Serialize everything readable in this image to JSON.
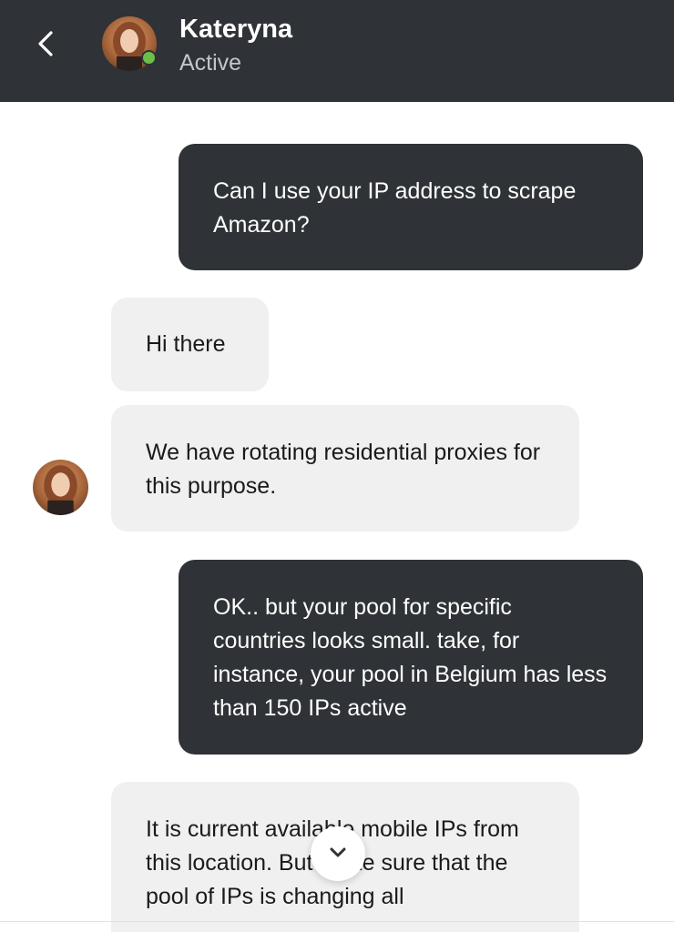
{
  "header": {
    "back_icon": "chevron-left-icon",
    "contact_name": "Kateryna",
    "status": "Active",
    "status_color": "#6cc04a",
    "background": "#2f3236"
  },
  "messages": [
    {
      "direction": "outgoing",
      "text": "Can I use your IP address to scrape Amazon?"
    },
    {
      "direction": "incoming",
      "text": "Hi there"
    },
    {
      "direction": "incoming",
      "text": "We have rotating residential proxies for this purpose."
    },
    {
      "direction": "outgoing",
      "text": "OK.. but your pool for specific countries looks small. take, for instance, your pool in Belgium has less than 150 IPs active"
    },
    {
      "direction": "incoming",
      "text": "It is current available mobile IPs from this location. But make sure that the pool of IPs is changing all"
    }
  ],
  "scroll_button": {
    "icon": "chevron-down-icon"
  },
  "colors": {
    "outgoing_bubble": "#2f3236",
    "incoming_bubble": "#f0f0f0"
  }
}
